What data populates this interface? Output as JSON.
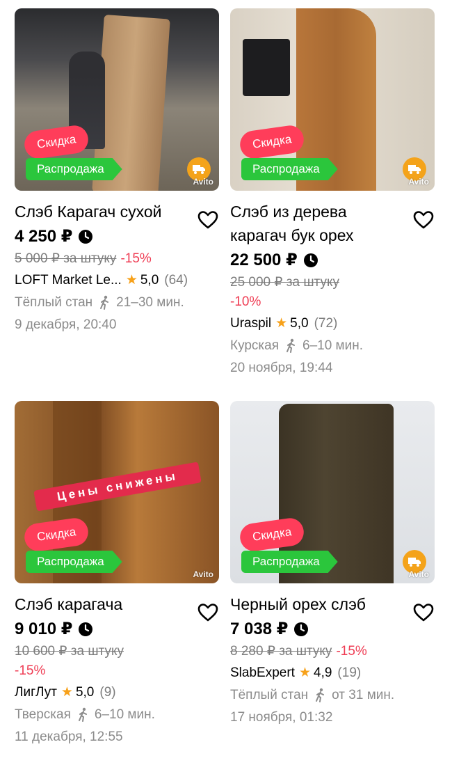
{
  "colors": {
    "discount_badge": "#ff3d5a",
    "sale_badge": "#2bc63c",
    "discount_text": "#ef3d54",
    "star": "#f7a11a"
  },
  "listings": [
    {
      "title": "Слэб Карагач сухой",
      "price": "4 250 ₽",
      "old_price": "5 000 ₽ за штуку",
      "discount": "-15%",
      "seller": "LOFT Market Le...",
      "rating": "5,0",
      "reviews": "(64)",
      "location": "Тёплый стан",
      "walk_time": "21–30 мин.",
      "date": "9 декабря, 20:40",
      "badge_discount": "Скидка",
      "badge_sale": "Распродажа",
      "watermark": "Avito"
    },
    {
      "title": "Слэб из дерева карагач бук орех",
      "price": "22 500 ₽",
      "old_price": "25 000 ₽ за штуку",
      "discount": "-10%",
      "seller": "Uraspil",
      "rating": "5,0",
      "reviews": "(72)",
      "location": "Курская",
      "walk_time": "6–10 мин.",
      "date": "20 ноября, 19:44",
      "badge_discount": "Скидка",
      "badge_sale": "Распродажа",
      "watermark": "Avito"
    },
    {
      "title": "Слэб карагача",
      "price": "9 010 ₽",
      "old_price": "10 600 ₽ за штуку",
      "discount": "-15%",
      "seller": "ЛигЛут",
      "rating": "5,0",
      "reviews": "(9)",
      "location": "Тверская",
      "walk_time": "6–10 мин.",
      "date": "11 декабря, 12:55",
      "badge_discount": "Скидка",
      "badge_sale": "Распродажа",
      "photo_ribbon": "Цены снижены",
      "watermark": "Avito"
    },
    {
      "title": "Черный орех слэб",
      "price": "7 038 ₽",
      "old_price": "8 280 ₽ за штуку",
      "discount": "-15%",
      "seller": "SlabExpert",
      "rating": "4,9",
      "reviews": "(19)",
      "location": "Тёплый стан",
      "walk_time": "от 31 мин.",
      "date": "17 ноября, 01:32",
      "badge_discount": "Скидка",
      "badge_sale": "Распродажа",
      "watermark": "Avito"
    }
  ]
}
